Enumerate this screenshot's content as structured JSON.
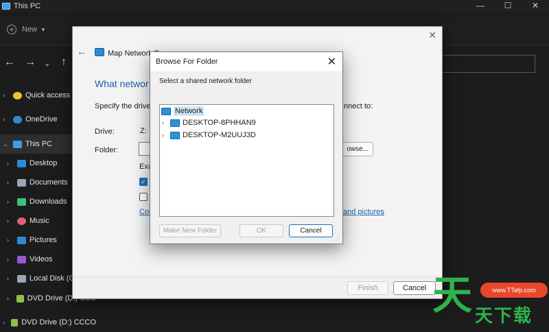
{
  "explorer": {
    "title": "This PC",
    "window_buttons": [
      "—",
      "☐",
      "✕"
    ],
    "new_label": "New",
    "tree": [
      {
        "label": "Quick access",
        "color": "#f2c230"
      },
      {
        "label": "OneDrive",
        "color": "#2f8ad3"
      },
      {
        "label": "This PC",
        "color": "#3aa0e8"
      },
      {
        "label": "Desktop",
        "color": "#2f8ad3"
      },
      {
        "label": "Documents",
        "color": "#9aa7b5"
      },
      {
        "label": "Downloads",
        "color": "#3ac27a"
      },
      {
        "label": "Music",
        "color": "#e0607a"
      },
      {
        "label": "Pictures",
        "color": "#2f8ad3"
      },
      {
        "label": "Videos",
        "color": "#9b59d0"
      },
      {
        "label": "Local Disk (C",
        "color": "#9aa7b5"
      },
      {
        "label": "DVD Drive (D:) CCC",
        "color": "#8fbf4a"
      },
      {
        "label": "DVD Drive (D:) CCCO",
        "color": "#8fbf4a"
      }
    ]
  },
  "map_drive": {
    "header": "Map Network D",
    "heading": "What networ",
    "specify": "Specify the drive",
    "connect_to": "nnect to:",
    "drive_label": "Drive:",
    "drive_value": "Z:",
    "folder_label": "Folder:",
    "browse_label": "owse...",
    "example": "Exa",
    "link1": "Con",
    "link2": "and pictures",
    "link2_suffix": ".",
    "finish": "Finish",
    "cancel": "Cancel"
  },
  "browse_folder": {
    "title": "Browse For Folder",
    "close": "✕",
    "instruction": "Select a shared network folder",
    "root": "Network",
    "children": [
      "DESKTOP-8PHHAN9",
      "DESKTOP-M2UUJ3D"
    ],
    "make_new_folder": "Make New Folder",
    "ok": "OK",
    "cancel": "Cancel"
  },
  "watermark": {
    "big": "天",
    "url": "www.TTafp.com",
    "small": "天下载"
  }
}
